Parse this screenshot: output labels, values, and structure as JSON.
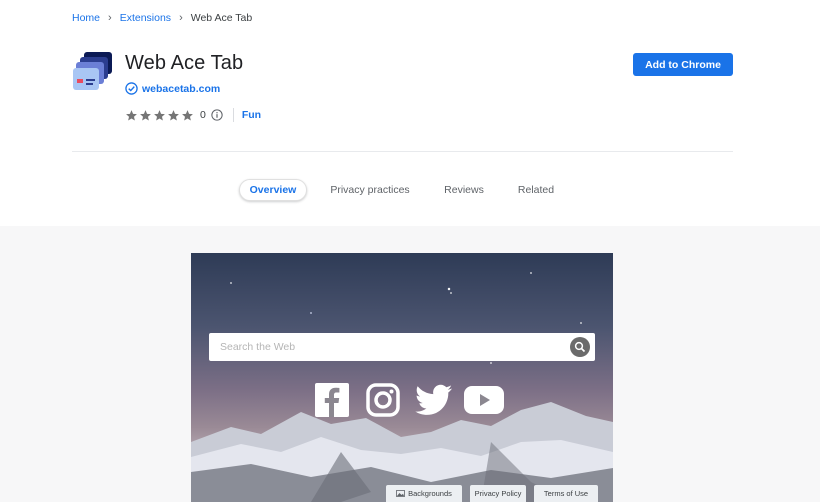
{
  "breadcrumb": {
    "home": "Home",
    "extensions": "Extensions",
    "current": "Web Ace Tab"
  },
  "extension": {
    "name": "Web Ace Tab",
    "publisher": "webacetab.com",
    "rating_value": 0,
    "rating_count": "0",
    "category": "Fun",
    "add_button": "Add to Chrome"
  },
  "tabs": [
    {
      "label": "Overview",
      "active": true
    },
    {
      "label": "Privacy practices",
      "active": false
    },
    {
      "label": "Reviews",
      "active": false
    },
    {
      "label": "Related",
      "active": false
    }
  ],
  "screenshot": {
    "search_placeholder": "Search the Web",
    "social_icons": [
      "facebook-icon",
      "instagram-icon",
      "twitter-icon",
      "youtube-icon"
    ],
    "footer": {
      "backgrounds": "Backgrounds",
      "privacy": "Privacy Policy",
      "terms": "Terms of Use"
    }
  },
  "colors": {
    "accent": "#1a73e8",
    "text": "#202124",
    "muted": "#5f6368",
    "gallery_bg": "#f7f7f8"
  }
}
